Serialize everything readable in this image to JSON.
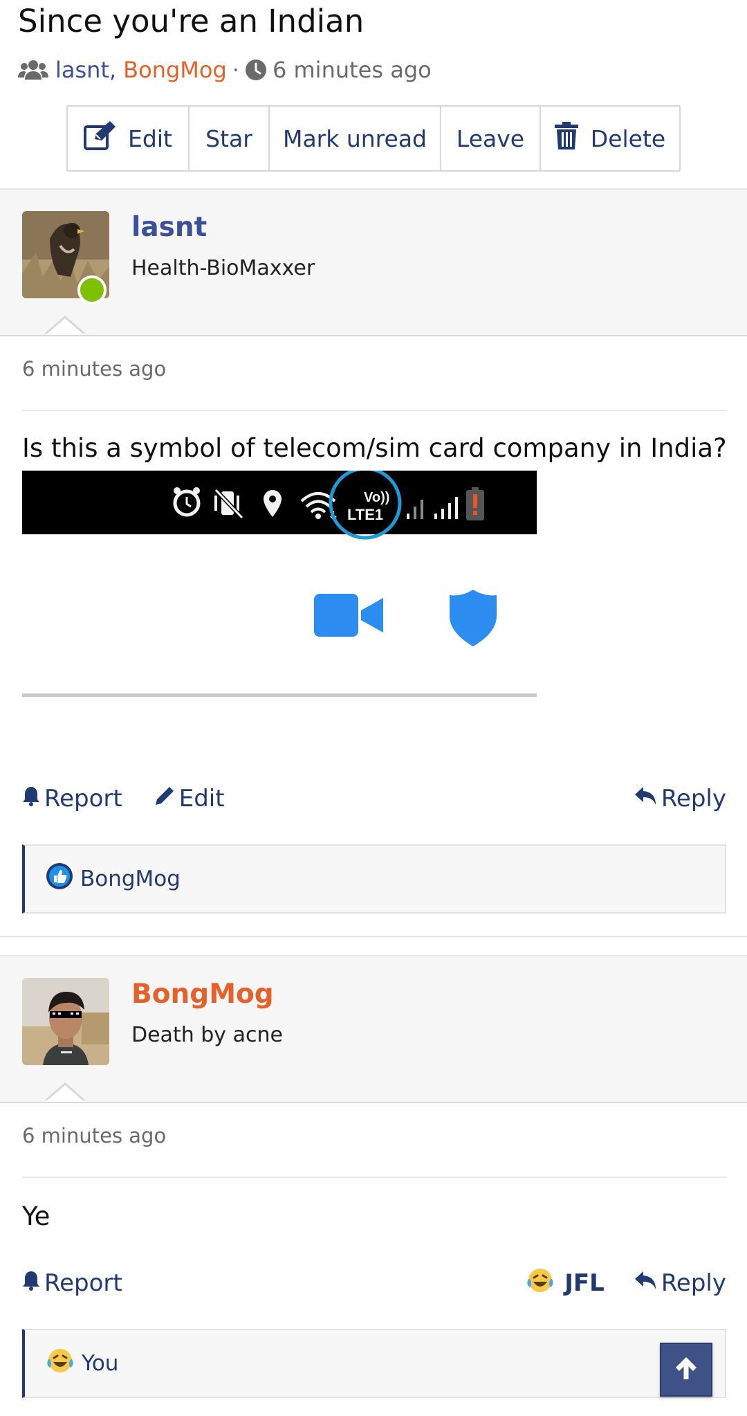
{
  "thread": {
    "title": "Since you're an Indian",
    "participants": [
      "lasnt",
      "BongMog"
    ],
    "separator": "·",
    "comma": ",",
    "time": "6 minutes ago"
  },
  "toolbar": {
    "edit": "Edit",
    "star": "Star",
    "mark_unread": "Mark unread",
    "leave": "Leave",
    "delete": "Delete"
  },
  "posts": [
    {
      "author": "lasnt",
      "author_color": "#3b4f9b",
      "subtitle": "Health-BioMaxxer",
      "online": true,
      "time": "6 minutes ago",
      "text": "Is this a symbol of telecom/sim card company in India?",
      "image_status_label_top": "Vo))",
      "image_status_label_bottom": "LTE1",
      "actions": {
        "report": "Report",
        "edit": "Edit",
        "reply": "Reply"
      },
      "reaction_user": "BongMog"
    },
    {
      "author": "BongMog",
      "author_color": "#e4622a",
      "subtitle": "Death by acne",
      "time": "6 minutes ago",
      "text": "Ye",
      "actions": {
        "report": "Report",
        "reaction": "JFL",
        "reply": "Reply"
      },
      "reaction_user": "You"
    }
  ],
  "colors": {
    "accent": "#223a72",
    "online": "#7cc000",
    "circle": "#1e9ad6",
    "video": "#2d8cf0"
  }
}
